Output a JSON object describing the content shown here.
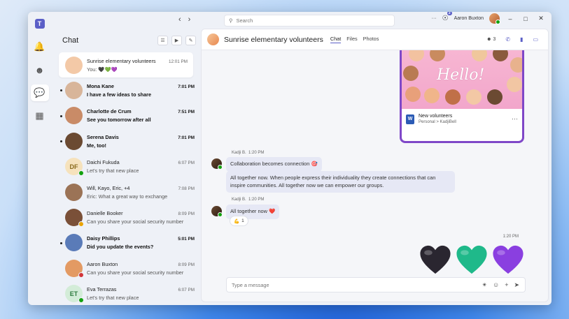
{
  "app": {
    "title": "Microsoft Teams"
  },
  "rail": {
    "items": [
      {
        "name": "notifications",
        "icon": "bell-icon"
      },
      {
        "name": "communities",
        "icon": "communities-icon"
      },
      {
        "name": "chat",
        "icon": "chat-icon",
        "active": true
      },
      {
        "name": "calendar",
        "icon": "calendar-icon"
      }
    ]
  },
  "topbar": {
    "search_placeholder": "Search",
    "more": "···",
    "notification_count": "3",
    "user_name": "Aaron Buxton"
  },
  "chatlist": {
    "title": "Chat",
    "items": [
      {
        "name": "Sunrise elementary volunteers",
        "time": "12:01 PM",
        "preview": "You: 🖤💚💜",
        "bold": false,
        "selected": true,
        "avatar_bg": "#f3c9a7",
        "initials": ""
      },
      {
        "name": "Mona Kane",
        "time": "7:01 PM",
        "preview": "I have a few ideas to share",
        "bold": true,
        "avatar_bg": "#d8b59a",
        "initials": ""
      },
      {
        "name": "Charlotte de Crum",
        "time": "7:51 PM",
        "preview": "See you tomorrow after all",
        "bold": true,
        "avatar_bg": "#c98b67",
        "initials": ""
      },
      {
        "name": "Serena Davis",
        "time": "7:01 PM",
        "preview": "Me, too!",
        "bold": true,
        "avatar_bg": "#6b4a32",
        "initials": ""
      },
      {
        "name": "Daichi Fukuda",
        "time": "6:07 PM",
        "preview": "Let's try that new place",
        "bold": false,
        "avatar_bg": "#f6e2bc",
        "initials": "DF",
        "initials_color": "#8a6a1d",
        "presence": "#13a10e"
      },
      {
        "name": "Will, Kayo, Eric, +4",
        "time": "7:08 PM",
        "preview": "Eric: What a great way to exchange",
        "bold": false,
        "avatar_bg": "#9b7356",
        "initials": ""
      },
      {
        "name": "Danielle Booker",
        "time": "8:09 PM",
        "preview": "Can you share your social security number",
        "bold": false,
        "avatar_bg": "#7a5038",
        "initials": "",
        "presence": "#eaa300"
      },
      {
        "name": "Daisy Phillips",
        "time": "5:01 PM",
        "preview": "Did you update the events?",
        "bold": true,
        "avatar_bg": "#5a7bb8",
        "initials": ""
      },
      {
        "name": "Aaron Buxton",
        "time": "8:09 PM",
        "preview": "Can you share your social security number",
        "bold": false,
        "avatar_bg": "#e39a63",
        "initials": "",
        "presence": "#d13438"
      },
      {
        "name": "Eva Terrazas",
        "time": "6:07 PM",
        "preview": "Let's try that new place",
        "bold": false,
        "avatar_bg": "#d3ecd8",
        "initials": "ET",
        "initials_color": "#2d7a3e",
        "presence": "#13a10e"
      }
    ]
  },
  "conversation": {
    "title": "Sunrise elementary volunteers",
    "tabs": [
      "Chat",
      "Files",
      "Photos"
    ],
    "participant_count": "3",
    "image_card": {
      "art_text": "Hello!",
      "file_name": "New volunteers",
      "file_meta": "Personal > KadjiBell",
      "file_icon": "W"
    },
    "messages": [
      {
        "sender": "Kadji B.",
        "time": "1:20 PM",
        "bubbles": [
          "Collaboration becomes connection 🎯",
          "All together now. When people express their individuality they create connections that can inspire communities. All together now we can empower our groups."
        ]
      },
      {
        "sender": "Kadji B.",
        "time": "1:20 PM",
        "bubbles": [
          "All together now ❤️"
        ],
        "reaction": {
          "emoji": "💪",
          "count": "1"
        }
      }
    ],
    "my_time": "1:20 PM",
    "hearts": [
      "#2a2630",
      "#1fb98a",
      "#8a3fe0"
    ],
    "compose_placeholder": "Type a message"
  },
  "colors": {
    "accent": "#5b5fc7",
    "card_border": "#7f47c8"
  }
}
